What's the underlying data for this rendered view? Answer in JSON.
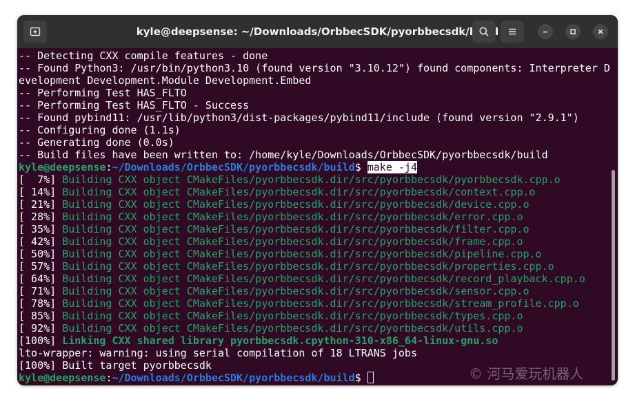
{
  "window": {
    "title": "kyle@deepsense: ~/Downloads/OrbbecSDK/pyorbbecsdk/build",
    "icons": [
      "new-tab-icon",
      "search-icon",
      "hamburger-menu-icon",
      "minimize-icon",
      "maximize-icon",
      "close-icon"
    ]
  },
  "colors": {
    "terminal_bg": "#300a24",
    "titlebar_bg": "#303030",
    "prompt_user": "#26a269",
    "prompt_path": "#2a7bde",
    "build_text": "#26a269"
  },
  "terminal": {
    "pre_lines": [
      "-- Detecting CXX compile features - done",
      "-- Found Python3: /usr/bin/python3.10 (found version \"3.10.12\") found components: Interpreter D",
      "evelopment Development.Module Development.Embed",
      "-- Performing Test HAS_FLTO",
      "-- Performing Test HAS_FLTO - Success",
      "-- Found pybind11: /usr/lib/python3/dist-packages/pybind11/include (found version \"2.9.1\")",
      "-- Configuring done (1.1s)",
      "-- Generating done (0.0s)",
      "-- Build files have been written to: /home/kyle/Downloads/OrbbecSDK/pyorbbecsdk/build"
    ],
    "prompt1": {
      "user": "kyle@deepsense",
      "sep": ":",
      "path": "~/Downloads/OrbbecSDK/pyorbbecsdk/build",
      "dollar": "$ ",
      "command": "make -j4"
    },
    "build_lines": [
      {
        "pct": "[  7%] ",
        "text": "Building CXX object CMakeFiles/pyorbbecsdk.dir/src/pyorbbecsdk/pyorbbecsdk.cpp.o"
      },
      {
        "pct": "[ 14%] ",
        "text": "Building CXX object CMakeFiles/pyorbbecsdk.dir/src/pyorbbecsdk/context.cpp.o"
      },
      {
        "pct": "[ 21%] ",
        "text": "Building CXX object CMakeFiles/pyorbbecsdk.dir/src/pyorbbecsdk/device.cpp.o"
      },
      {
        "pct": "[ 28%] ",
        "text": "Building CXX object CMakeFiles/pyorbbecsdk.dir/src/pyorbbecsdk/error.cpp.o"
      },
      {
        "pct": "[ 35%] ",
        "text": "Building CXX object CMakeFiles/pyorbbecsdk.dir/src/pyorbbecsdk/filter.cpp.o"
      },
      {
        "pct": "[ 42%] ",
        "text": "Building CXX object CMakeFiles/pyorbbecsdk.dir/src/pyorbbecsdk/frame.cpp.o"
      },
      {
        "pct": "[ 50%] ",
        "text": "Building CXX object CMakeFiles/pyorbbecsdk.dir/src/pyorbbecsdk/pipeline.cpp.o"
      },
      {
        "pct": "[ 57%] ",
        "text": "Building CXX object CMakeFiles/pyorbbecsdk.dir/src/pyorbbecsdk/properties.cpp.o"
      },
      {
        "pct": "[ 64%] ",
        "text": "Building CXX object CMakeFiles/pyorbbecsdk.dir/src/pyorbbecsdk/record_playback.cpp.o"
      },
      {
        "pct": "[ 71%] ",
        "text": "Building CXX object CMakeFiles/pyorbbecsdk.dir/src/pyorbbecsdk/sensor.cpp.o"
      },
      {
        "pct": "[ 78%] ",
        "text": "Building CXX object CMakeFiles/pyorbbecsdk.dir/src/pyorbbecsdk/stream_profile.cpp.o"
      },
      {
        "pct": "[ 85%] ",
        "text": "Building CXX object CMakeFiles/pyorbbecsdk.dir/src/pyorbbecsdk/types.cpp.o"
      },
      {
        "pct": "[ 92%] ",
        "text": "Building CXX object CMakeFiles/pyorbbecsdk.dir/src/pyorbbecsdk/utils.cpp.o"
      }
    ],
    "link_line": {
      "pct": "[100%] ",
      "text": "Linking CXX shared library pyorbbecsdk.cpython-310-x86_64-linux-gnu.so"
    },
    "warning_line": "lto-wrapper: warning: using serial compilation of 18 LTRANS jobs",
    "built_line": "[100%] Built target pyorbbecsdk",
    "prompt2": {
      "user": "kyle@deepsense",
      "sep": ":",
      "path": "~/Downloads/OrbbecSDK/pyorbbecsdk/build",
      "dollar": "$ "
    }
  },
  "watermark": "© 河马爱玩机器人"
}
